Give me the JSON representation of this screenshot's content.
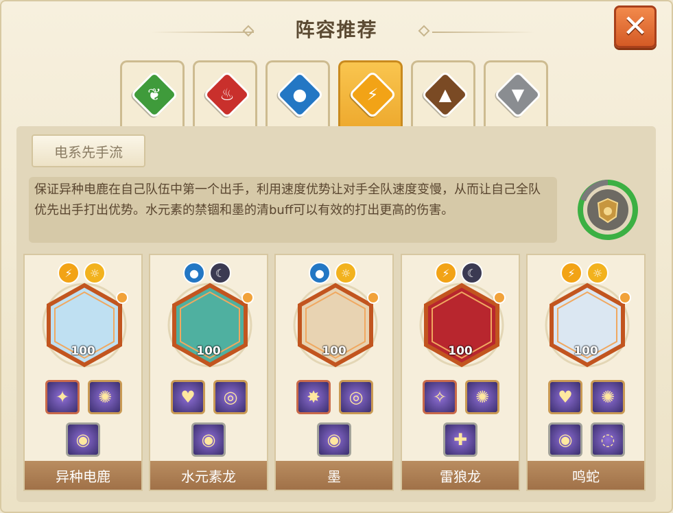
{
  "title": "阵容推荐",
  "close_label": "✕",
  "tabs": [
    {
      "element": "grass",
      "icon": "leaf-icon",
      "color": "#3f9b3b",
      "glyph": "❦",
      "active": false
    },
    {
      "element": "fire",
      "icon": "flame-icon",
      "color": "#c9302c",
      "glyph": "♨",
      "active": false
    },
    {
      "element": "water",
      "icon": "water-drop-icon",
      "color": "#2377c4",
      "glyph": "●",
      "active": false
    },
    {
      "element": "electric",
      "icon": "lightning-icon",
      "color": "#f2a316",
      "glyph": "⚡",
      "active": true
    },
    {
      "element": "ground",
      "icon": "mountain-icon",
      "color": "#7a4a24",
      "glyph": "▲",
      "active": false
    },
    {
      "element": "metal",
      "icon": "bolt-icon",
      "color": "#8a8d91",
      "glyph": "▼",
      "active": false
    }
  ],
  "strategy": {
    "name": "电系先手流",
    "description": "保证异种电鹿在自己队伍中第一个出手，利用速度优势让对手全队速度变慢，从而让自己全队优先出手打出优势。水元素的禁锢和墨的清buff可以有效的打出更高的伤害。"
  },
  "team": [
    {
      "name": "异种电鹿",
      "level": "100",
      "elements": [
        "electric",
        "light"
      ],
      "portrait_color": "#bfe0f2",
      "items": [
        {
          "color": "#c96a4a",
          "glyph": "✦"
        },
        {
          "color": "#c99a54",
          "glyph": "✺"
        },
        {
          "color": "#a2a29a",
          "glyph": "◉"
        }
      ]
    },
    {
      "name": "水元素龙",
      "level": "100",
      "elements": [
        "water",
        "dark"
      ],
      "portrait_color": "#4fb0a0",
      "items": [
        {
          "color": "#c99a54",
          "glyph": "♥"
        },
        {
          "color": "#c99a54",
          "glyph": "◎"
        },
        {
          "color": "#a2a29a",
          "glyph": "◉"
        }
      ]
    },
    {
      "name": "墨",
      "level": "100",
      "elements": [
        "water",
        "light"
      ],
      "portrait_color": "#e8d3b2",
      "items": [
        {
          "color": "#c96a4a",
          "glyph": "✸"
        },
        {
          "color": "#c99a54",
          "glyph": "◎"
        },
        {
          "color": "#a2a29a",
          "glyph": "◉"
        }
      ]
    },
    {
      "name": "雷狼龙",
      "level": "100",
      "elements": [
        "electric",
        "dark"
      ],
      "portrait_color": "#b8262e",
      "items": [
        {
          "color": "#c96a4a",
          "glyph": "✧"
        },
        {
          "color": "#c99a54",
          "glyph": "✺"
        },
        {
          "color": "#a2a29a",
          "glyph": "✚"
        }
      ]
    },
    {
      "name": "鸣蛇",
      "level": "100",
      "elements": [
        "electric",
        "light"
      ],
      "portrait_color": "#dbe7f2",
      "items": [
        {
          "color": "#c99a54",
          "glyph": "♥"
        },
        {
          "color": "#c99a54",
          "glyph": "✺"
        },
        {
          "color": "#a2a29a",
          "glyph": "◉"
        },
        {
          "color": "#a2a29a",
          "glyph": "◌"
        }
      ]
    }
  ],
  "element_styles": {
    "electric": {
      "color": "#f2a316",
      "glyph": "⚡",
      "icon": "lightning-icon"
    },
    "light": {
      "color": "#f2b21e",
      "glyph": "☼",
      "icon": "sun-icon"
    },
    "water": {
      "color": "#2377c4",
      "glyph": "●",
      "icon": "water-drop-icon"
    },
    "dark": {
      "color": "#3b3a52",
      "glyph": "☾",
      "icon": "moon-icon"
    }
  }
}
